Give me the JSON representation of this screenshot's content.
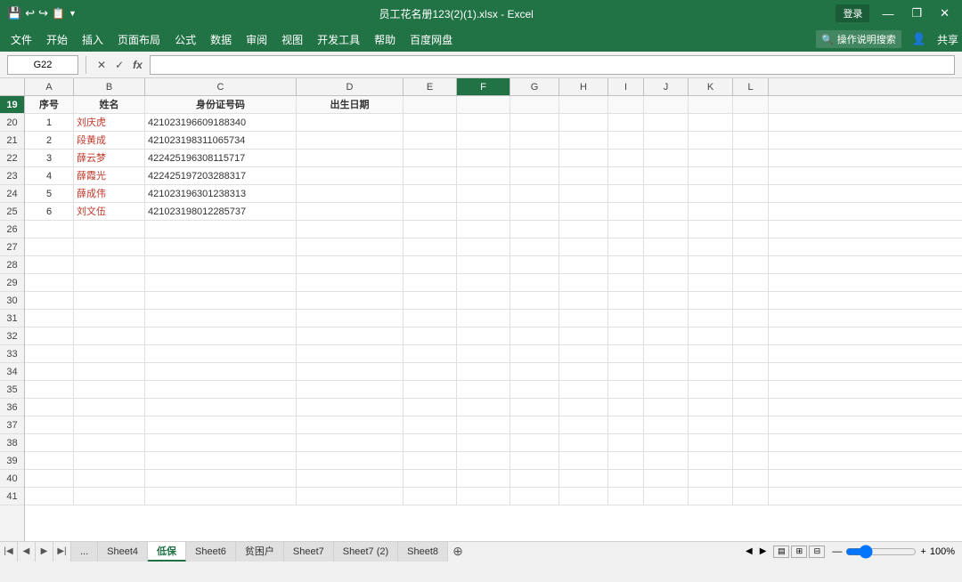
{
  "titlebar": {
    "title": "员工花名册123(2)(1).xlsx - Excel",
    "login_btn": "登录",
    "save_icon": "💾",
    "undo_icon": "↩",
    "redo_icon": "↪",
    "quick_icon": "📋",
    "dropdown_icon": "▼",
    "min_btn": "—",
    "restore_btn": "❐",
    "close_btn": "✕"
  },
  "menubar": {
    "items": [
      "文件",
      "开始",
      "插入",
      "页面布局",
      "公式",
      "数据",
      "审阅",
      "视图",
      "开发工具",
      "帮助",
      "百度网盘"
    ],
    "search_placeholder": "操作说明搜索",
    "share_label": "共享"
  },
  "toolbar": {
    "cell_ref": "G22",
    "formula": "",
    "cancel_label": "✕",
    "confirm_label": "✓",
    "fx_label": "fx"
  },
  "columns": {
    "headers": [
      "A",
      "B",
      "C",
      "D",
      "E",
      "F",
      "G",
      "H",
      "I",
      "J",
      "K",
      "L"
    ]
  },
  "rows": {
    "row_numbers": [
      19,
      20,
      21,
      22,
      23,
      24,
      25,
      26,
      27,
      28,
      29,
      30,
      31,
      32,
      33,
      34,
      35,
      36,
      37,
      38,
      39,
      40,
      41
    ],
    "header": {
      "row_num": 19,
      "cells": [
        "序号",
        "姓名",
        "身份证号码",
        "出生日期",
        "",
        "",
        "",
        "",
        "",
        "",
        "",
        ""
      ]
    },
    "data": [
      {
        "row_num": 20,
        "cells": [
          "1",
          "刘庆虎",
          "421023196609188340",
          "",
          "",
          "",
          "",
          "",
          "",
          "",
          "",
          ""
        ]
      },
      {
        "row_num": 21,
        "cells": [
          "2",
          "段黄成",
          "421023198311065734",
          "",
          "",
          "",
          "",
          "",
          "",
          "",
          "",
          ""
        ]
      },
      {
        "row_num": 22,
        "cells": [
          "3",
          "薛云梦",
          "422425196308115717",
          "",
          "",
          "",
          "",
          "",
          "",
          "",
          "",
          ""
        ]
      },
      {
        "row_num": 23,
        "cells": [
          "4",
          "薛霞光",
          "422425197203288317",
          "",
          "",
          "",
          "",
          "",
          "",
          "",
          "",
          ""
        ]
      },
      {
        "row_num": 24,
        "cells": [
          "5",
          "薛成伟",
          "421023196301238313",
          "",
          "",
          "",
          "",
          "",
          "",
          "",
          "",
          ""
        ]
      },
      {
        "row_num": 25,
        "cells": [
          "6",
          "刘文伍",
          "421023198012285737",
          "",
          "",
          "",
          "",
          "",
          "",
          "",
          "",
          ""
        ]
      }
    ],
    "empty_count": 16
  },
  "sheets": {
    "tabs": [
      "...",
      "Sheet4",
      "低保",
      "Sheet6",
      "贫困户",
      "Sheet7",
      "Sheet7 (2)",
      "Sheet8"
    ],
    "active": "低保",
    "add_label": "+"
  },
  "statusbar": {
    "zoom": "100%"
  }
}
